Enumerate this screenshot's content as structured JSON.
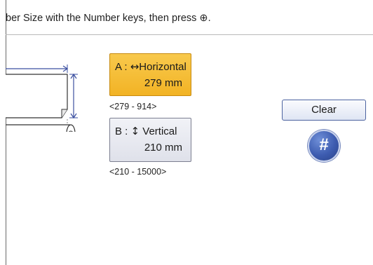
{
  "instruction": {
    "text": "ber Size with the Number keys, then press ⊕."
  },
  "horizontal_button": {
    "prefix": "A : ",
    "symbol": "↔",
    "label": "Horizontal",
    "value": "279 mm",
    "color": "#f2b325"
  },
  "horizontal_range": "<279 - 914>",
  "vertical_button": {
    "prefix": "B : ",
    "symbol": "↕",
    "label": " Vertical",
    "value": "210 mm",
    "color": "#e6e8f0"
  },
  "vertical_range": "<210 - 15000>",
  "clear_button": {
    "label": "Clear"
  },
  "hash_button": {
    "label": "#",
    "color": "#3d5cb0"
  },
  "illustration": {
    "icon": "paper-roll-dimension-icon",
    "accent": "#3b4fa0"
  }
}
